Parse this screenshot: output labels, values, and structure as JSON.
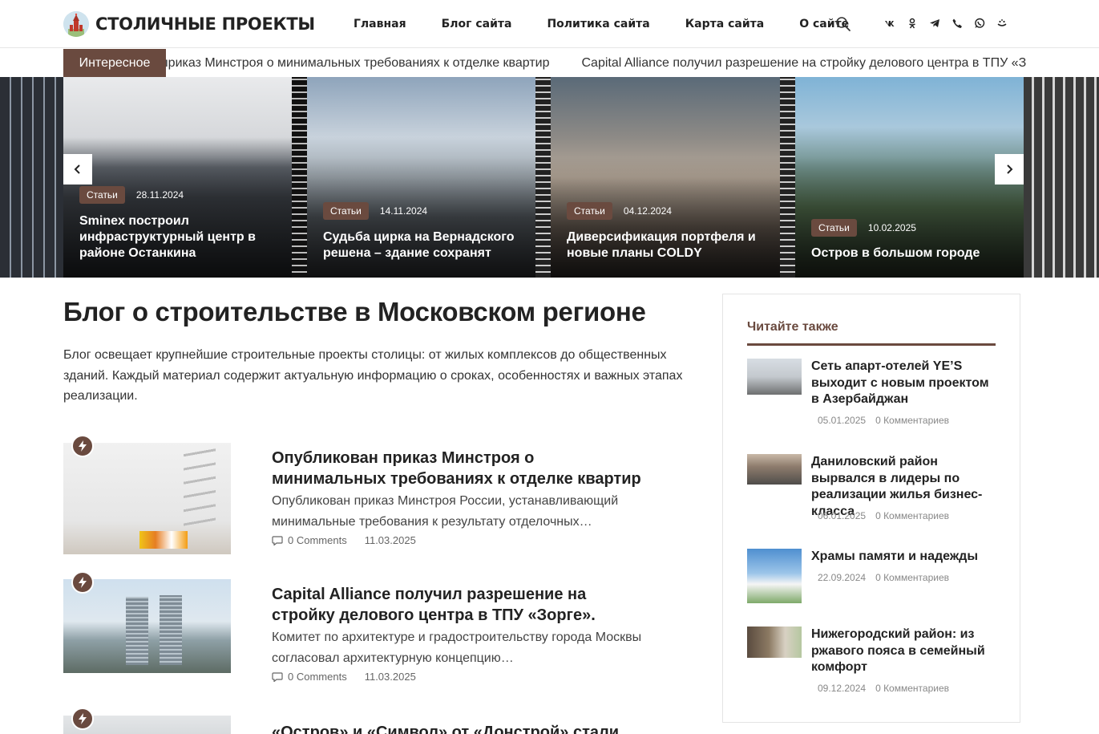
{
  "header": {
    "logo_text": "СТОЛИЧНЫЕ ПРОЕКТЫ",
    "nav": [
      {
        "label": "Главная"
      },
      {
        "label": "Блог сайта"
      },
      {
        "label": "Политика сайта"
      },
      {
        "label": "Карта сайта"
      },
      {
        "label": "О сайте"
      }
    ],
    "social_icons": [
      "vk-icon",
      "odnoklassniki-icon",
      "telegram-icon",
      "viber-icon",
      "whatsapp-icon",
      "max-icon"
    ]
  },
  "ticker": {
    "label": "Интересное",
    "items": [
      "приказ Минстроя о минимальных требованиях к отделке квартир",
      "Capital Alliance получил разрешение на стройку делового центра в ТПУ «Зорге»."
    ]
  },
  "slider": {
    "slides": [
      {
        "badge": "Статьи",
        "date": "28.11.2024",
        "title": "Sminex построил инфраструктурный центр в районе Останкина"
      },
      {
        "badge": "Статьи",
        "date": "14.11.2024",
        "title": "Судьба цирка на Вернадского решена – здание сохранят"
      },
      {
        "badge": "Статьи",
        "date": "04.12.2024",
        "title": "Диверсификация портфеля и новые планы COLDY"
      },
      {
        "badge": "Статьи",
        "date": "10.02.2025",
        "title": "Остров в большом городе"
      }
    ]
  },
  "main": {
    "title": "Блог о строительстве в Московском регионе",
    "intro": "Блог освещает крупнейшие строительные проекты столицы: от жилых комплексов до общественных зданий. Каждый материал содержит актуальную информацию о сроках, особенностях и важных этапах реализации.",
    "posts": [
      {
        "title": "Опубликован приказ Минстроя о минимальных требованиях к отделке квартир",
        "excerpt": "Опубликован приказ Минстроя России, устанавливающий минимальные требования к результату отделочных…",
        "comments": "0 Comments",
        "date": "11.03.2025"
      },
      {
        "title": "Capital Alliance получил разрешение на стройку делового центра в ТПУ «Зорге».",
        "excerpt": "Комитет по архитектуре и градостроительству города Москвы согласовал архитектурную концепцию…",
        "comments": "0 Comments",
        "date": "11.03.2025"
      },
      {
        "title": "«Остров» и «Символ» от «Донстрой» стали",
        "excerpt": "",
        "comments": "",
        "date": ""
      }
    ]
  },
  "sidebar": {
    "title": "Читайте также",
    "items": [
      {
        "title": "Сеть апарт-отелей YE’S выходит с новым проектом в Азербайджан",
        "date": "05.01.2025",
        "comments": "0 Комментариев"
      },
      {
        "title": "Даниловский район вырвался в лидеры по реализации жилья бизнес-класса",
        "date": "06.01.2025",
        "comments": "0 Комментариев"
      },
      {
        "title": "Храмы памяти и надежды",
        "date": "22.09.2024",
        "comments": "0 Комментариев"
      },
      {
        "title": "Нижегородский район: из ржавого пояса в семейный комфорт",
        "date": "09.12.2024",
        "comments": "0 Комментариев"
      }
    ]
  },
  "colors": {
    "accent": "#6a4a3f",
    "text": "#222222",
    "muted": "#888888"
  }
}
